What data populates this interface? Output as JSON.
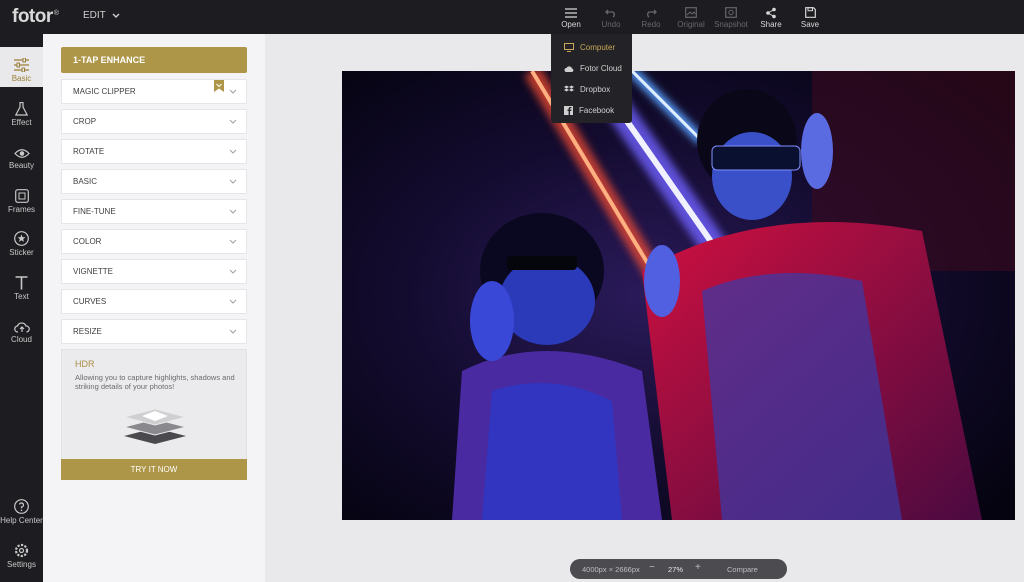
{
  "app": {
    "logo": "fotor",
    "logo_mark": "®",
    "edit_menu": "EDIT"
  },
  "toolbar": [
    {
      "id": "open",
      "label": "Open",
      "icon": "hamburger-icon",
      "enabled": true
    },
    {
      "id": "undo",
      "label": "Undo",
      "icon": "undo-icon",
      "enabled": false
    },
    {
      "id": "redo",
      "label": "Redo",
      "icon": "redo-icon",
      "enabled": false
    },
    {
      "id": "original",
      "label": "Original",
      "icon": "image-icon",
      "enabled": false
    },
    {
      "id": "snapshot",
      "label": "Snapshot",
      "icon": "snapshot-icon",
      "enabled": false
    },
    {
      "id": "share",
      "label": "Share",
      "icon": "share-icon",
      "enabled": true
    },
    {
      "id": "save",
      "label": "Save",
      "icon": "save-icon",
      "enabled": true
    }
  ],
  "open_menu": [
    {
      "label": "Computer",
      "icon": "monitor-icon"
    },
    {
      "label": "Fotor Cloud",
      "icon": "cloud-icon"
    },
    {
      "label": "Dropbox",
      "icon": "dropbox-icon"
    },
    {
      "label": "Facebook",
      "icon": "facebook-icon"
    }
  ],
  "rail": [
    {
      "label": "Basic",
      "icon": "sliders-icon",
      "active": true
    },
    {
      "label": "Effect",
      "icon": "flask-icon"
    },
    {
      "label": "Beauty",
      "icon": "eye-icon"
    },
    {
      "label": "Frames",
      "icon": "frame-icon"
    },
    {
      "label": "Sticker",
      "icon": "star-icon"
    },
    {
      "label": "Text",
      "icon": "text-icon"
    },
    {
      "label": "Cloud",
      "icon": "cloud-upload-icon"
    }
  ],
  "rail_bottom": [
    {
      "label": "Help Center",
      "icon": "help-icon"
    },
    {
      "label": "Settings",
      "icon": "gear-icon"
    }
  ],
  "panel": {
    "enhance_label": "1-TAP ENHANCE",
    "sections": [
      "MAGIC CLIPPER",
      "CROP",
      "ROTATE",
      "BASIC",
      "FINE-TUNE",
      "COLOR",
      "VIGNETTE",
      "CURVES",
      "RESIZE"
    ],
    "hdr": {
      "title": "HDR",
      "description": "Allowing you to capture highlights, shadows and striking details of your photos!",
      "button": "TRY IT NOW"
    }
  },
  "zoom": {
    "dimensions": "4000px × 2666px",
    "minus": "−",
    "level": "27%",
    "plus": "+",
    "compare": "Compare"
  },
  "colors": {
    "accent": "#ae9648",
    "dark": "#1d1d21"
  }
}
